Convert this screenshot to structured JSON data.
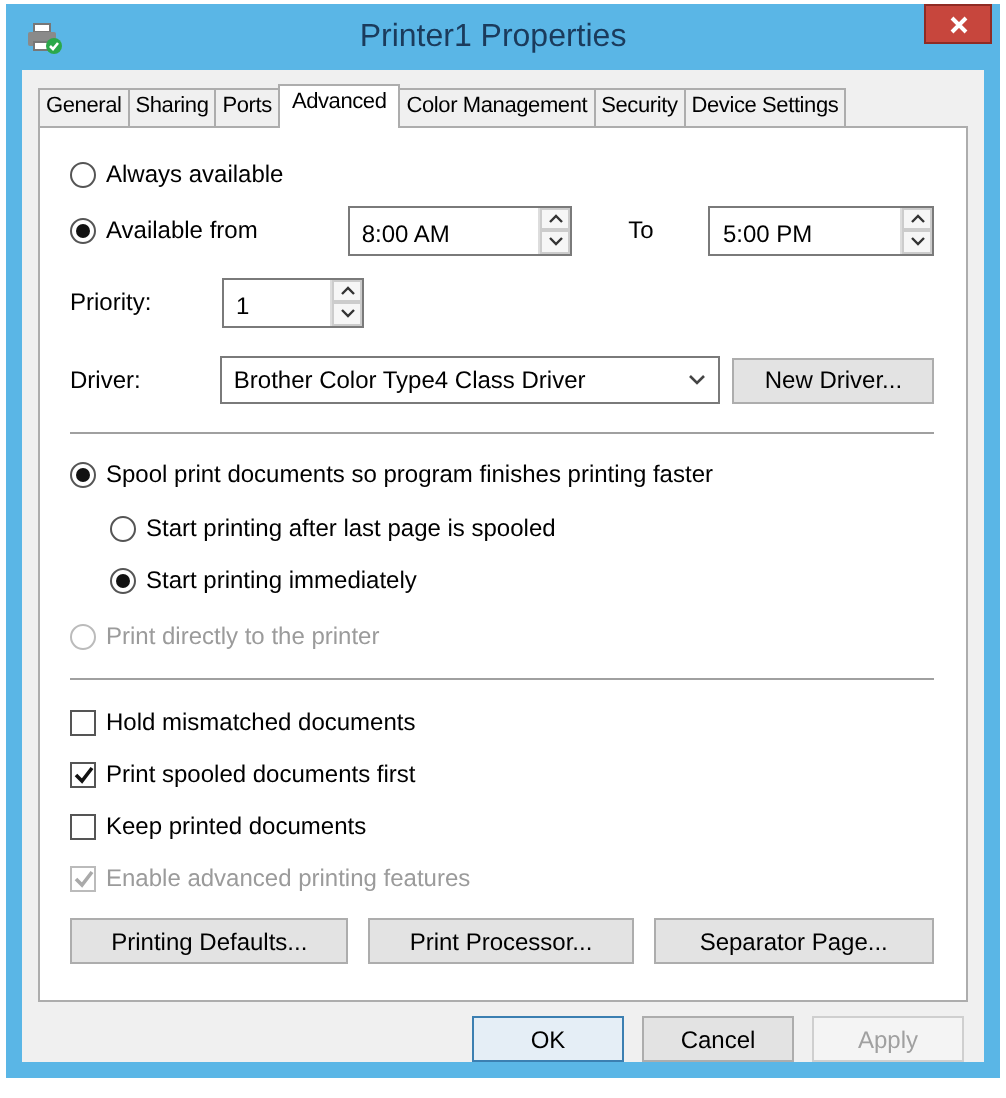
{
  "window": {
    "title": "Printer1 Properties"
  },
  "tabs": [
    {
      "label": "General",
      "selected": false
    },
    {
      "label": "Sharing",
      "selected": false
    },
    {
      "label": "Ports",
      "selected": false
    },
    {
      "label": "Advanced",
      "selected": true
    },
    {
      "label": "Color Management",
      "selected": false
    },
    {
      "label": "Security",
      "selected": false
    },
    {
      "label": "Device Settings",
      "selected": false
    }
  ],
  "availability": {
    "options": [
      {
        "label": "Always available",
        "selected": false
      },
      {
        "label": "Available from",
        "selected": true
      }
    ],
    "from_value": "8:00 AM",
    "to_label": "To",
    "to_value": "5:00 PM"
  },
  "priority": {
    "label": "Priority:",
    "value": "1"
  },
  "driver": {
    "label": "Driver:",
    "value": "Brother Color Type4 Class Driver",
    "button": "New Driver..."
  },
  "spooling": [
    {
      "label": "Spool print documents so program finishes printing faster",
      "selected": true,
      "disabled": false,
      "children": [
        {
          "label": "Start printing after last page is spooled",
          "selected": false,
          "disabled": false
        },
        {
          "label": "Start printing immediately",
          "selected": true,
          "disabled": false
        }
      ]
    },
    {
      "label": "Print directly to the printer",
      "selected": false,
      "disabled": true
    }
  ],
  "checkboxes": [
    {
      "label": "Hold mismatched documents",
      "checked": false,
      "disabled": false
    },
    {
      "label": "Print spooled documents first",
      "checked": true,
      "disabled": false
    },
    {
      "label": "Keep printed documents",
      "checked": false,
      "disabled": false
    },
    {
      "label": "Enable advanced printing features",
      "checked": true,
      "disabled": true
    }
  ],
  "action_buttons": [
    "Printing Defaults...",
    "Print Processor...",
    "Separator Page..."
  ],
  "dialog_buttons": [
    {
      "label": "OK",
      "disabled": false,
      "default": true
    },
    {
      "label": "Cancel",
      "disabled": false,
      "default": false
    },
    {
      "label": "Apply",
      "disabled": true,
      "default": false
    }
  ]
}
